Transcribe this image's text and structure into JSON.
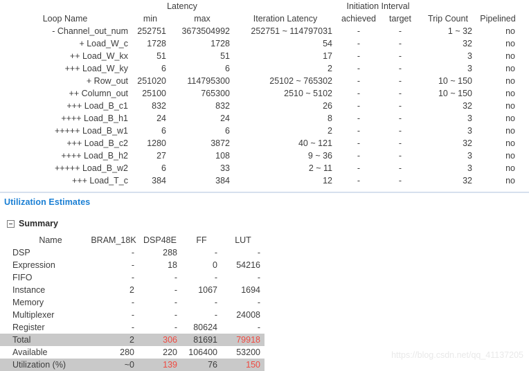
{
  "loop_table": {
    "group_headers": {
      "latency": "Latency",
      "initiation_interval": "Initiation Interval"
    },
    "columns": {
      "loop_name": "Loop Name",
      "min": "min",
      "max": "max",
      "iteration_latency": "Iteration Latency",
      "achieved": "achieved",
      "target": "target",
      "trip_count": "Trip Count",
      "pipelined": "Pipelined"
    },
    "rows": [
      {
        "name": "- Channel_out_num",
        "min": "252751",
        "max": "3673504992",
        "iteration_latency": "252751 ~ 114797031",
        "achieved": "-",
        "target": "-",
        "trip_count": "1 ~ 32",
        "pipelined": "no"
      },
      {
        "name": "+ Load_W_c",
        "min": "1728",
        "max": "1728",
        "iteration_latency": "54",
        "achieved": "-",
        "target": "-",
        "trip_count": "32",
        "pipelined": "no"
      },
      {
        "name": "++ Load_W_kx",
        "min": "51",
        "max": "51",
        "iteration_latency": "17",
        "achieved": "-",
        "target": "-",
        "trip_count": "3",
        "pipelined": "no"
      },
      {
        "name": "+++ Load_W_ky",
        "min": "6",
        "max": "6",
        "iteration_latency": "2",
        "achieved": "-",
        "target": "-",
        "trip_count": "3",
        "pipelined": "no"
      },
      {
        "name": "+ Row_out",
        "min": "251020",
        "max": "114795300",
        "iteration_latency": "25102 ~ 765302",
        "achieved": "-",
        "target": "-",
        "trip_count": "10 ~ 150",
        "pipelined": "no"
      },
      {
        "name": "++ Column_out",
        "min": "25100",
        "max": "765300",
        "iteration_latency": "2510 ~ 5102",
        "achieved": "-",
        "target": "-",
        "trip_count": "10 ~ 150",
        "pipelined": "no"
      },
      {
        "name": "+++ Load_B_c1",
        "min": "832",
        "max": "832",
        "iteration_latency": "26",
        "achieved": "-",
        "target": "-",
        "trip_count": "32",
        "pipelined": "no"
      },
      {
        "name": "++++ Load_B_h1",
        "min": "24",
        "max": "24",
        "iteration_latency": "8",
        "achieved": "-",
        "target": "-",
        "trip_count": "3",
        "pipelined": "no"
      },
      {
        "name": "+++++ Load_B_w1",
        "min": "6",
        "max": "6",
        "iteration_latency": "2",
        "achieved": "-",
        "target": "-",
        "trip_count": "3",
        "pipelined": "no"
      },
      {
        "name": "+++ Load_B_c2",
        "min": "1280",
        "max": "3872",
        "iteration_latency": "40 ~ 121",
        "achieved": "-",
        "target": "-",
        "trip_count": "32",
        "pipelined": "no"
      },
      {
        "name": "++++ Load_B_h2",
        "min": "27",
        "max": "108",
        "iteration_latency": "9 ~ 36",
        "achieved": "-",
        "target": "-",
        "trip_count": "3",
        "pipelined": "no"
      },
      {
        "name": "+++++ Load_B_w2",
        "min": "6",
        "max": "33",
        "iteration_latency": "2 ~ 11",
        "achieved": "-",
        "target": "-",
        "trip_count": "3",
        "pipelined": "no"
      },
      {
        "name": "+++ Load_T_c",
        "min": "384",
        "max": "384",
        "iteration_latency": "12",
        "achieved": "-",
        "target": "-",
        "trip_count": "32",
        "pipelined": "no"
      }
    ]
  },
  "utilization": {
    "section_title": "Utilization Estimates",
    "summary_label": "Summary",
    "columns": {
      "name": "Name",
      "bram": "BRAM_18K",
      "dsp": "DSP48E",
      "ff": "FF",
      "lut": "LUT"
    },
    "rows": [
      {
        "name": "DSP",
        "bram": "-",
        "dsp": "288",
        "ff": "-",
        "lut": "-"
      },
      {
        "name": "Expression",
        "bram": "-",
        "dsp": "18",
        "ff": "0",
        "lut": "54216"
      },
      {
        "name": "FIFO",
        "bram": "-",
        "dsp": "-",
        "ff": "-",
        "lut": "-"
      },
      {
        "name": "Instance",
        "bram": "2",
        "dsp": "-",
        "ff": "1067",
        "lut": "1694"
      },
      {
        "name": "Memory",
        "bram": "-",
        "dsp": "-",
        "ff": "-",
        "lut": "-"
      },
      {
        "name": "Multiplexer",
        "bram": "-",
        "dsp": "-",
        "ff": "-",
        "lut": "24008"
      },
      {
        "name": "Register",
        "bram": "-",
        "dsp": "-",
        "ff": "80624",
        "lut": "-"
      }
    ],
    "total": {
      "name": "Total",
      "bram": "2",
      "dsp": "306",
      "ff": "81691",
      "lut": "79918"
    },
    "available": {
      "name": "Available",
      "bram": "280",
      "dsp": "220",
      "ff": "106400",
      "lut": "53200"
    },
    "utilization": {
      "name": "Utilization (%)",
      "bram": "~0",
      "dsp": "139",
      "ff": "76",
      "lut": "150"
    }
  },
  "watermark": "https://blog.csdn.net/qq_41137205",
  "colors": {
    "section_title": "#1a7fd4",
    "over_budget": "#ef4a41",
    "highlight_row": "#c9c9c9",
    "text": "#3c3c3c"
  }
}
